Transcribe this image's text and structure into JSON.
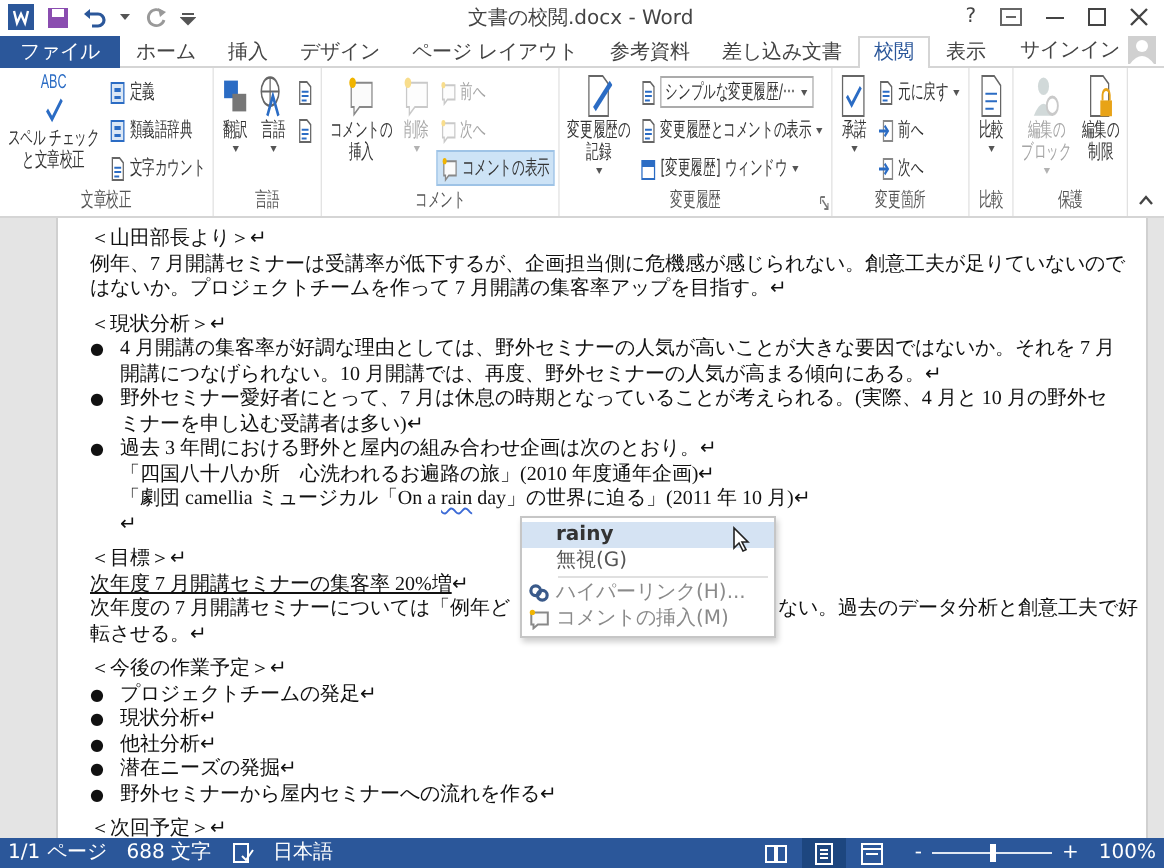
{
  "window": {
    "title": "文書の校閲.docx - Word",
    "help": "?"
  },
  "tabs": [
    {
      "label": "ファイル",
      "kind": "file",
      "selected": false
    },
    {
      "label": "ホーム",
      "kind": "tab",
      "selected": false
    },
    {
      "label": "挿入",
      "kind": "tab",
      "selected": false
    },
    {
      "label": "デザイン",
      "kind": "tab",
      "selected": false
    },
    {
      "label": "ページ レイアウト",
      "kind": "tab",
      "selected": false
    },
    {
      "label": "参考資料",
      "kind": "tab",
      "selected": false
    },
    {
      "label": "差し込み文書",
      "kind": "tab",
      "selected": false
    },
    {
      "label": "校閲",
      "kind": "tab",
      "selected": true
    },
    {
      "label": "表示",
      "kind": "tab",
      "selected": false
    }
  ],
  "account": {
    "label": "サインイン"
  },
  "ribbon": {
    "groups": [
      {
        "name": "文章校正",
        "commands": [
          {
            "kind": "large",
            "icon_text": "ABC",
            "label_lines": [
              "スペル チェック",
              "と文章校正"
            ],
            "dropdown": false,
            "disabled": false,
            "on": false
          },
          {
            "kind": "small",
            "label": "定義",
            "dropdown": false,
            "disabled": false,
            "on": false
          },
          {
            "kind": "small",
            "label": "類義語辞典",
            "dropdown": false,
            "disabled": false,
            "on": false
          },
          {
            "kind": "small",
            "label": "文字カウント",
            "dropdown": false,
            "disabled": false,
            "on": false
          }
        ]
      },
      {
        "name": "言語",
        "commands": [
          {
            "kind": "large",
            "label_lines": [
              "翻訳"
            ],
            "dropdown": true,
            "disabled": false,
            "on": false
          },
          {
            "kind": "large",
            "label_lines": [
              "言語"
            ],
            "dropdown": true,
            "disabled": false,
            "on": false
          },
          {
            "kind": "icon",
            "dropdown": false,
            "disabled": false,
            "on": false
          },
          {
            "kind": "icon",
            "dropdown": false,
            "disabled": false,
            "on": false
          }
        ]
      },
      {
        "name": "コメント",
        "commands": [
          {
            "kind": "large",
            "label_lines": [
              "コメントの",
              "挿入"
            ],
            "dropdown": false,
            "disabled": false,
            "on": false
          },
          {
            "kind": "large",
            "label_lines": [
              "削除"
            ],
            "dropdown": true,
            "disabled": true,
            "on": false
          },
          {
            "kind": "small",
            "label": "前へ",
            "dropdown": false,
            "disabled": true,
            "on": false
          },
          {
            "kind": "small",
            "label": "次へ",
            "dropdown": false,
            "disabled": true,
            "on": false
          },
          {
            "kind": "small",
            "label": "コメントの表示",
            "dropdown": false,
            "disabled": false,
            "on": true
          }
        ]
      },
      {
        "name": "変更履歴",
        "launcher": true,
        "commands": [
          {
            "kind": "large",
            "label_lines": [
              "変更履歴の",
              "記録"
            ],
            "dropdown": true,
            "disabled": false,
            "on": false
          },
          {
            "kind": "combo",
            "label": "シンプルな変更履歴/···",
            "dropdown": true,
            "disabled": false,
            "on": false
          },
          {
            "kind": "small",
            "label": "変更履歴とコメントの表示",
            "dropdown": true,
            "disabled": false,
            "on": false
          },
          {
            "kind": "small",
            "label": "[変更履歴] ウィンドウ",
            "dropdown": true,
            "disabled": false,
            "on": false
          }
        ]
      },
      {
        "name": "変更箇所",
        "commands": [
          {
            "kind": "large",
            "label_lines": [
              "承諾"
            ],
            "dropdown": true,
            "disabled": false,
            "on": false
          },
          {
            "kind": "small",
            "label": "元に戻す",
            "dropdown": true,
            "disabled": false,
            "on": false
          },
          {
            "kind": "small",
            "label": "前へ",
            "dropdown": false,
            "disabled": false,
            "on": false
          },
          {
            "kind": "small",
            "label": "次へ",
            "dropdown": false,
            "disabled": false,
            "on": false
          }
        ]
      },
      {
        "name": "比較",
        "commands": [
          {
            "kind": "large",
            "label_lines": [
              "比較"
            ],
            "dropdown": true,
            "disabled": false,
            "on": false
          }
        ]
      },
      {
        "name": "保護",
        "commands": [
          {
            "kind": "large",
            "label_lines": [
              "編集の",
              "ブロック"
            ],
            "dropdown": true,
            "disabled": true,
            "on": false
          },
          {
            "kind": "large",
            "label_lines": [
              "編集の",
              "制限"
            ],
            "dropdown": false,
            "disabled": false,
            "on": false
          }
        ]
      }
    ]
  },
  "document": {
    "paragraphs": [
      {
        "kind": "heading",
        "text": "＜山田部長より＞↵"
      },
      {
        "kind": "text",
        "text": "例年、7 月開講セミナーは受講率が低下するが、企画担当側に危機感が感じられない。創意工夫が足りていないのではないか。プロジェクトチームを作って 7 月開講の集客率アップを目指す。↵"
      },
      {
        "kind": "heading",
        "text": "＜現状分析＞↵"
      },
      {
        "kind": "bullet",
        "marker": "●",
        "text": "4 月開講の集客率が好調な理由としては、野外セミナーの人気が高いことが大きな要因ではないか。それを 7 月開講につなげられない。10 月開講では、再度、野外セミナーの人気が高まる傾向にある。↵"
      },
      {
        "kind": "bullet",
        "marker": "●",
        "text": "野外セミナー愛好者にとって、7 月は休息の時期となっていることが考えられる。(実際、4 月と 10 月の野外セミナーを申し込む受講者は多い)↵"
      },
      {
        "kind": "bullet",
        "marker": "●",
        "text": "過去 3 年間における野外と屋内の組み合わせ企画は次のとおり。↵"
      },
      {
        "kind": "indented",
        "text": "「四国八十八か所　心洗われるお遍路の旅」(2010 年度通年企画)↵"
      },
      {
        "kind": "flagged",
        "before": "「劇団 camellia ミュージカル「On a ",
        "flagged": "rain",
        "after": " day」の世界に迫る」(2011 年 10 月)↵"
      },
      {
        "kind": "indented",
        "text": "↵"
      },
      {
        "kind": "heading",
        "text": "＜目標＞↵"
      },
      {
        "kind": "underlined",
        "text": "次年度 7 月開講セミナーの集客率 20%増↵"
      },
      {
        "kind": "covered",
        "before": "次年度の 7 月開講セミナーについては「例年ど",
        "after": "ない。過去のデータ分析と創意工夫で好",
        "continued": "転させる。↵"
      },
      {
        "kind": "heading",
        "text": "＜今後の作業予定＞↵"
      },
      {
        "kind": "bullet",
        "marker": "●",
        "text": "プロジェクトチームの発足↵"
      },
      {
        "kind": "bullet",
        "marker": "●",
        "text": "現状分析↵"
      },
      {
        "kind": "bullet",
        "marker": "●",
        "text": "他社分析↵"
      },
      {
        "kind": "bullet",
        "marker": "●",
        "text": "潜在ニーズの発掘↵"
      },
      {
        "kind": "bullet",
        "marker": "●",
        "text": "野外セミナーから屋内セミナーへの流れを作る↵"
      },
      {
        "kind": "heading",
        "text": "＜次回予定＞↵"
      }
    ]
  },
  "context_menu": {
    "items": [
      {
        "kind": "suggestion",
        "label": "rainy",
        "selected": true
      },
      {
        "kind": "plain",
        "label": "無視(G)",
        "selected": false
      },
      {
        "kind": "separator"
      },
      {
        "kind": "hyperlink",
        "label": "ハイパーリンク(H)...",
        "selected": false
      },
      {
        "kind": "comment",
        "label": "コメントの挿入(M)",
        "selected": false
      }
    ]
  },
  "status_bar": {
    "page": "1/1 ページ",
    "words": "688 文字",
    "language": "日本語",
    "views": [
      {
        "selected": false
      },
      {
        "selected": true
      },
      {
        "selected": false
      }
    ],
    "zoom_out": "-",
    "zoom": {
      "level": 0.5
    },
    "zoom_in": "+",
    "zoom_reading": "100%"
  }
}
